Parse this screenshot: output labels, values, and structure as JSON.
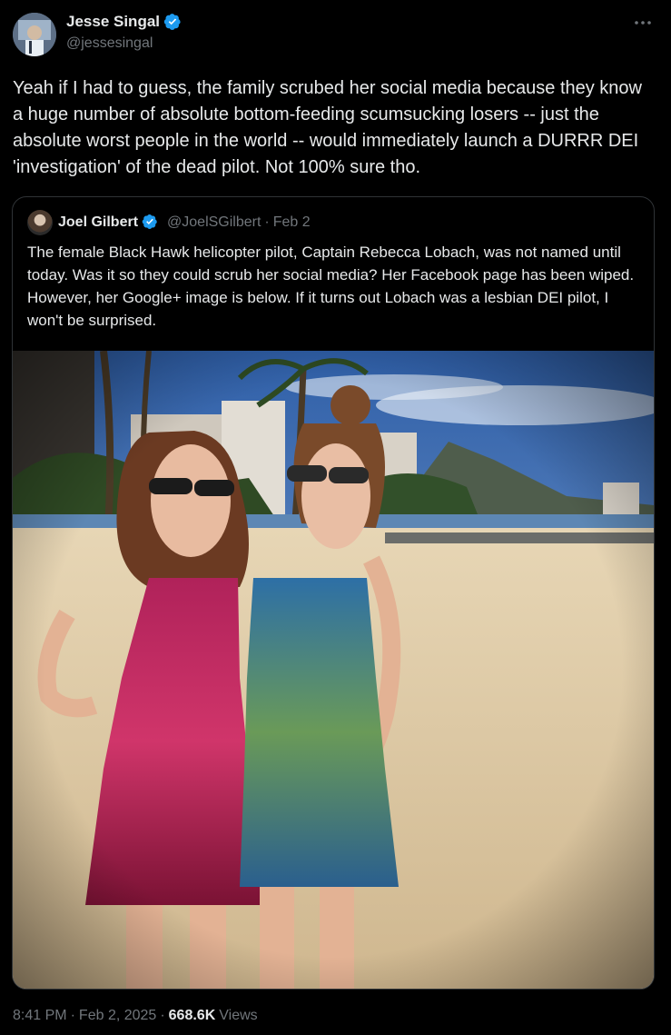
{
  "author": {
    "name": "Jesse Singal",
    "handle": "@jessesingal"
  },
  "tweet": {
    "text": "Yeah if I had to guess, the family scrubed her social media because they know a huge number of absolute bottom-feeding scumsucking losers -- just the absolute worst people in the world -- would immediately launch a DURRR DEI 'investigation' of the dead pilot. Not 100% sure tho."
  },
  "quoted": {
    "name": "Joel Gilbert",
    "handle": "@JoelSGilbert",
    "separator": "·",
    "date": "Feb 2",
    "text": "The female Black Hawk helicopter pilot, Captain Rebecca Lobach, was not named until today. Was it so they could scrub her social media? Her Facebook page has been wiped. However, her Google+ image is below. If it turns out Lobach was a lesbian DEI pilot, I won't be surprised."
  },
  "footer": {
    "time": "8:41 PM",
    "sep1": "·",
    "date": "Feb 2, 2025",
    "sep2": "·",
    "views_count": "668.6K",
    "views_label": "Views"
  },
  "icons": {
    "verified": "verified-badge-icon",
    "more": "more-icon"
  },
  "colors": {
    "background": "#000000",
    "text": "#e7e9ea",
    "muted": "#71767b",
    "verified": "#1d9bf0",
    "border": "#2f3336"
  }
}
